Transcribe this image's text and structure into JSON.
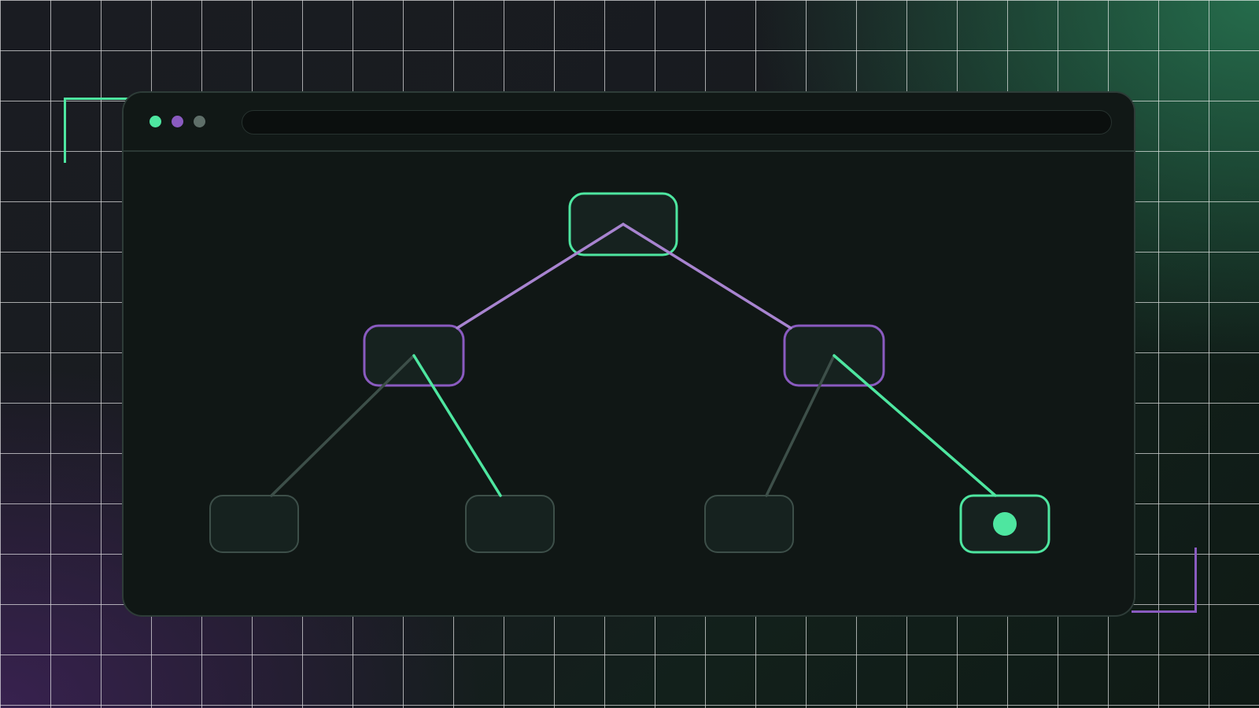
{
  "colors": {
    "accent_green": "#4ee6a0",
    "accent_purple": "#8a5bc0",
    "edge_purple": "#a884d0",
    "muted_grey": "#3d4f49",
    "window_bg": "#101715",
    "node_fill": "#16221f"
  },
  "window": {
    "controls": [
      "green-dot",
      "purple-dot",
      "grey-dot"
    ],
    "address_bar": ""
  },
  "tree": {
    "nodes": [
      {
        "id": "root",
        "level": 0,
        "style": "green-outline"
      },
      {
        "id": "left-child",
        "level": 1,
        "style": "purple-outline"
      },
      {
        "id": "right-child",
        "level": 1,
        "style": "purple-outline"
      },
      {
        "id": "leaf-1",
        "level": 2,
        "style": "muted"
      },
      {
        "id": "leaf-2",
        "level": 2,
        "style": "muted"
      },
      {
        "id": "leaf-3",
        "level": 2,
        "style": "muted"
      },
      {
        "id": "leaf-4",
        "level": 2,
        "style": "green-outline",
        "marker": "filled-dot"
      }
    ],
    "edges": [
      {
        "from": "root",
        "to": "left-child",
        "style": "purple"
      },
      {
        "from": "root",
        "to": "right-child",
        "style": "purple"
      },
      {
        "from": "left-child",
        "to": "leaf-1",
        "style": "muted"
      },
      {
        "from": "left-child",
        "to": "leaf-2",
        "style": "green"
      },
      {
        "from": "right-child",
        "to": "leaf-3",
        "style": "muted"
      },
      {
        "from": "right-child",
        "to": "leaf-4",
        "style": "green"
      }
    ],
    "highlighted_path": [
      "root",
      "right-child",
      "leaf-4"
    ]
  }
}
